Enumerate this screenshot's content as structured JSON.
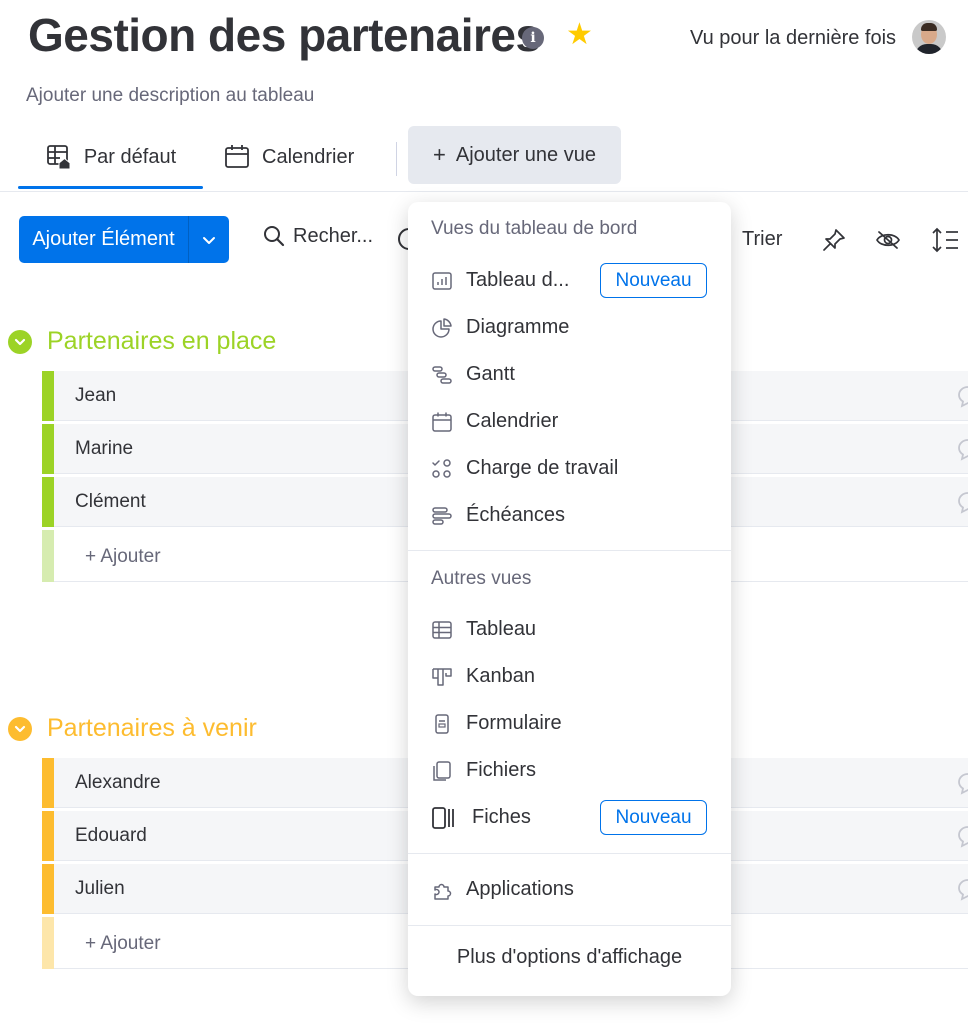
{
  "header": {
    "title": "Gestion des partenaires",
    "info_icon": "info-icon",
    "favorite_icon": "star-icon",
    "last_seen_label": "Vu pour la dernière fois",
    "description_placeholder": "Ajouter une description au tableau"
  },
  "views": {
    "tabs": [
      {
        "label": "Par défaut",
        "icon": "table-home-icon",
        "active": true
      },
      {
        "label": "Calendrier",
        "icon": "calendar-icon",
        "active": false
      }
    ],
    "add_view_label": "Ajouter une vue"
  },
  "toolbar": {
    "add_item_label": "Ajouter Élément",
    "search_label": "Recher...",
    "sort_label": "Trier"
  },
  "groups": [
    {
      "title": "Partenaires en place",
      "color": "#9cd326",
      "light_color": "#d6ecb0",
      "items": [
        "Jean",
        "Marine",
        "Clément"
      ],
      "add_label": "+ Ajouter"
    },
    {
      "title": "Partenaires à venir",
      "color": "#fdbc2f",
      "light_color": "#fde6aa",
      "items": [
        "Alexandre",
        "Edouard",
        "Julien"
      ],
      "add_label": "+ Ajouter"
    }
  ],
  "dropdown": {
    "section_dashboard": "Vues du tableau de bord",
    "dashboard_items": [
      {
        "label": "Tableau d...",
        "icon": "dashboard-chart-icon",
        "badge": "Nouveau"
      },
      {
        "label": "Diagramme",
        "icon": "pie-chart-icon"
      },
      {
        "label": "Gantt",
        "icon": "gantt-icon"
      },
      {
        "label": "Calendrier",
        "icon": "calendar-icon"
      },
      {
        "label": "Charge de travail",
        "icon": "workload-icon"
      },
      {
        "label": "Échéances",
        "icon": "timeline-icon"
      }
    ],
    "section_other": "Autres vues",
    "other_items": [
      {
        "label": "Tableau",
        "icon": "table-icon"
      },
      {
        "label": "Kanban",
        "icon": "kanban-icon"
      },
      {
        "label": "Formulaire",
        "icon": "form-icon"
      },
      {
        "label": "Fichiers",
        "icon": "files-icon"
      },
      {
        "label": "Fiches",
        "icon": "cards-icon",
        "badge": "Nouveau"
      }
    ],
    "apps_label": "Applications",
    "apps_icon": "puzzle-icon",
    "more_label": "Plus d'options d'affichage"
  },
  "colors": {
    "accent": "#0073ea",
    "text": "#323338",
    "secondary_text": "#676879",
    "row_background": "#f5f6f8"
  }
}
